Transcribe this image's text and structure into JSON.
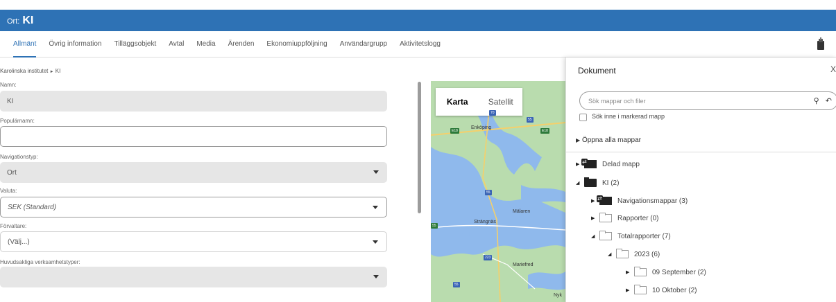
{
  "title": {
    "prefix": "Ort:",
    "name": "KI"
  },
  "tabs": [
    "Allmänt",
    "Övrig information",
    "Tilläggsobjekt",
    "Avtal",
    "Media",
    "Ärenden",
    "Ekonomiuppföljning",
    "Användargrupp",
    "Aktivitetslogg"
  ],
  "active_tab": "Allmänt",
  "breadcrumb": {
    "parent": "Karolinska institutet",
    "sep": "►",
    "current": "KI"
  },
  "form": {
    "name_label": "Namn:",
    "name_value": "KI",
    "popular_label": "Populärnamn:",
    "popular_value": "",
    "navtype_label": "Navigationstyp:",
    "navtype_value": "Ort",
    "currency_label": "Valuta:",
    "currency_value": "SEK (Standard)",
    "manager_label": "Förvaltare:",
    "manager_value": "(Välj...)",
    "business_label": "Huvudsakliga verksamhetstyper:",
    "business_value": ""
  },
  "map": {
    "toggle_map": "Karta",
    "toggle_sat": "Satellit",
    "places": [
      "Enköping",
      "Strängnäs",
      "Mälaren",
      "Mariefred",
      "Nyk"
    ],
    "shields": [
      "70",
      "55",
      "E18",
      "E18",
      "55",
      "55",
      "223",
      "55"
    ]
  },
  "panel": {
    "title": "Dokument",
    "close": "X",
    "search_placeholder": "Sök mappar och filer",
    "search_icon": "search-icon",
    "reset_icon": "reset-icon",
    "checkbox_label": "Sök inne i markerad mapp",
    "open_all": "Öppna alla mappar",
    "tree": [
      {
        "label": "Delad mapp",
        "type": "shared",
        "expanded": false
      },
      {
        "label": "KI (2)",
        "type": "dark",
        "expanded": true
      },
      {
        "label": "Navigationsmappar (3)",
        "type": "shared",
        "expanded": false
      },
      {
        "label": "Rapporter (0)",
        "type": "light",
        "expanded": false
      },
      {
        "label": "Totalrapporter (7)",
        "type": "light",
        "expanded": true
      },
      {
        "label": "2023 (6)",
        "type": "light",
        "expanded": true
      },
      {
        "label": "09 September (2)",
        "type": "light",
        "expanded": false
      },
      {
        "label": "10 Oktober (2)",
        "type": "light",
        "expanded": false
      }
    ]
  },
  "colors": {
    "primary": "#2e72b5",
    "field_grey": "#e6e6e6"
  }
}
